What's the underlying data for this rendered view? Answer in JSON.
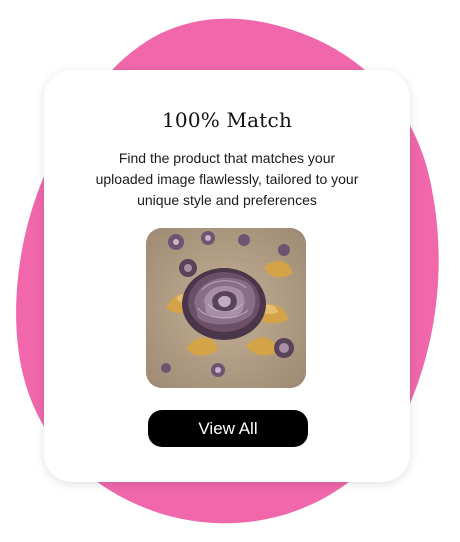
{
  "card": {
    "title": "100% Match",
    "description": "Find the product that matches your uploaded image flawlessly, tailored to your unique style and preferences",
    "image_subject": "embroidered-rose-fabric",
    "button_label": "View All"
  },
  "colors": {
    "blob": "#f068ab",
    "card_bg": "#ffffff",
    "button_bg": "#000000",
    "button_text": "#ffffff"
  }
}
